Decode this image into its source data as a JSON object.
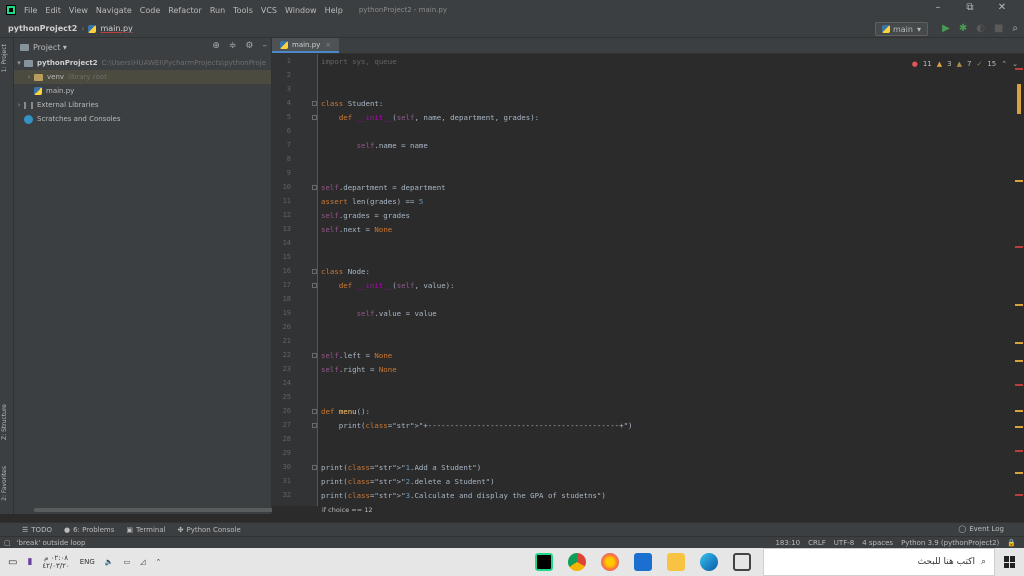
{
  "menubar": {
    "items": [
      "File",
      "Edit",
      "View",
      "Navigate",
      "Code",
      "Refactor",
      "Run",
      "Tools",
      "VCS",
      "Window",
      "Help"
    ],
    "title": "pythonProject2 - main.py",
    "controls": [
      "–",
      "⧉",
      "✕"
    ]
  },
  "navbar": {
    "project": "pythonProject2",
    "file": "main.py",
    "run_config": "main"
  },
  "sidebar": {
    "project_tab": "1: Project",
    "structure_tab": "Z: Structure",
    "favorites_tab": "2: Favorites",
    "header": "Project ▾"
  },
  "tree": {
    "root_name": "pythonProject2",
    "root_path": "C:\\Users\\HUAWEI\\PycharmProjects\\pythonProje",
    "venv": "venv",
    "venv_note": "library root",
    "file": "main.py",
    "external": "External Libraries",
    "scratches": "Scratches and Consoles"
  },
  "editor": {
    "tab": "main.py",
    "errors": "11",
    "warnings": "3",
    "weak_warnings": "7",
    "typos": "15",
    "breadcrumb": "if choice == 12",
    "lines": [
      {
        "n": "1",
        "t": "import sys, queue"
      },
      {
        "n": "2",
        "t": ""
      },
      {
        "n": "3",
        "t": ""
      },
      {
        "n": "4",
        "t": "class Student:"
      },
      {
        "n": "5",
        "t": "    def __init__(self, name, department, grades):"
      },
      {
        "n": "6",
        "t": ""
      },
      {
        "n": "7",
        "t": "        self.name = name"
      },
      {
        "n": "8",
        "t": ""
      },
      {
        "n": "9",
        "t": ""
      },
      {
        "n": "10",
        "t": "self.department = department"
      },
      {
        "n": "11",
        "t": "assert len(grades) == 5"
      },
      {
        "n": "12",
        "t": "self.grades = grades"
      },
      {
        "n": "13",
        "t": "self.next = None"
      },
      {
        "n": "14",
        "t": ""
      },
      {
        "n": "15",
        "t": ""
      },
      {
        "n": "16",
        "t": "class Node:"
      },
      {
        "n": "17",
        "t": "    def __init__(self, value):"
      },
      {
        "n": "18",
        "t": ""
      },
      {
        "n": "19",
        "t": "        self.value = value"
      },
      {
        "n": "20",
        "t": ""
      },
      {
        "n": "21",
        "t": ""
      },
      {
        "n": "22",
        "t": "self.left = None"
      },
      {
        "n": "23",
        "t": "self.right = None"
      },
      {
        "n": "24",
        "t": ""
      },
      {
        "n": "25",
        "t": ""
      },
      {
        "n": "26",
        "t": "def menu():"
      },
      {
        "n": "27",
        "t": "    print(\"+-------------------------------------------+\")"
      },
      {
        "n": "28",
        "t": ""
      },
      {
        "n": "29",
        "t": ""
      },
      {
        "n": "30",
        "t": "print(\"1.Add a Student\")"
      },
      {
        "n": "31",
        "t": "print(\"2.delete a Student\")"
      },
      {
        "n": "32",
        "t": "print(\"3.Calculate and display the GPA of studetns\")"
      }
    ]
  },
  "toolwindows": {
    "todo": "TODO",
    "problems": "6: Problems",
    "terminal": "Terminal",
    "console": "Python Console",
    "event_log": "Event Log"
  },
  "statusbar": {
    "message": "'break' outside loop",
    "position": "183:10",
    "line_sep": "CRLF",
    "encoding": "UTF-8",
    "indent": "4 spaces",
    "interpreter": "Python 3.9 (pythonProject2)"
  },
  "taskbar": {
    "time": "٠٢:٠٨ م",
    "date": "٤٢/٠٣/٢٠",
    "lang": "ENG",
    "search_placeholder": "اكتب هنا للبحث"
  },
  "colors": {
    "keyword": "#cc7832",
    "function": "#ffc66d",
    "self": "#94558d",
    "number": "#6897bb",
    "string": "#6a8759",
    "dunder": "#b200b2"
  }
}
